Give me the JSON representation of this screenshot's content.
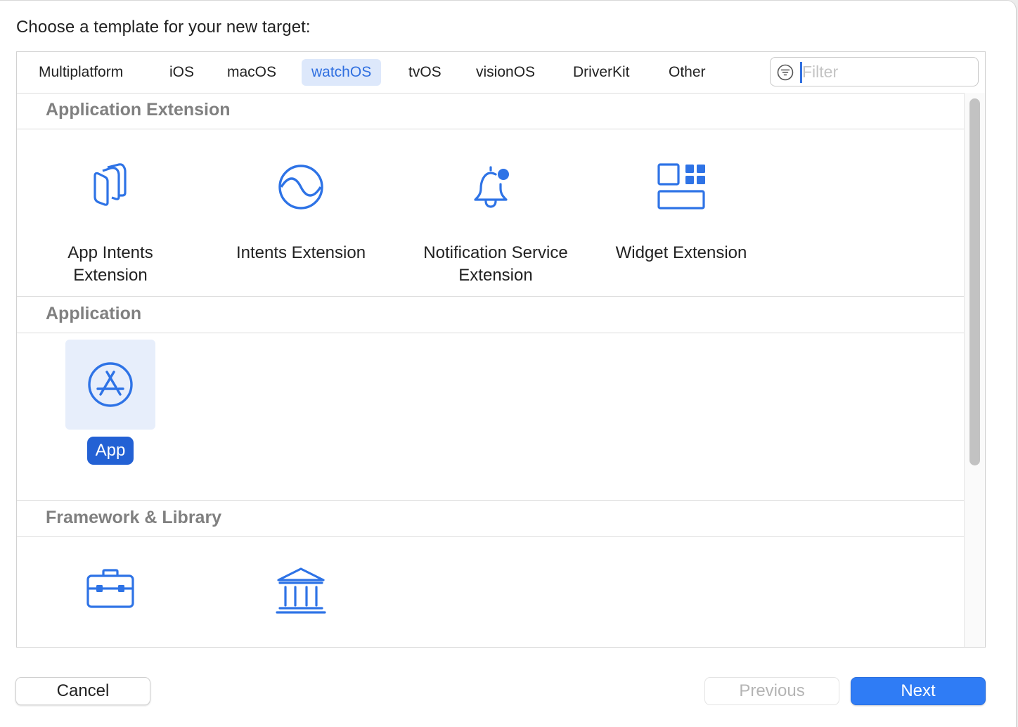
{
  "dialog": {
    "prompt": "Choose a template for your new target:"
  },
  "tabs": [
    {
      "label": "Multiplatform"
    },
    {
      "label": "iOS"
    },
    {
      "label": "macOS"
    },
    {
      "label": "watchOS",
      "selected": true
    },
    {
      "label": "tvOS"
    },
    {
      "label": "visionOS"
    },
    {
      "label": "DriverKit"
    },
    {
      "label": "Other"
    }
  ],
  "filter": {
    "placeholder": "Filter",
    "value": ""
  },
  "sections": [
    {
      "title": "Application Extension",
      "items": [
        {
          "label": "App Intents Extension",
          "icon": "app-intents-icon"
        },
        {
          "label": "Intents Extension",
          "icon": "intents-icon"
        },
        {
          "label": "Notification Service Extension",
          "icon": "bell-badge-icon"
        },
        {
          "label": "Widget Extension",
          "icon": "widget-grid-icon"
        }
      ]
    },
    {
      "title": "Application",
      "items": [
        {
          "label": "App",
          "icon": "app-store-icon",
          "selected": true
        }
      ]
    },
    {
      "title": "Framework & Library",
      "items": [
        {
          "label": "",
          "icon": "toolbox-icon"
        },
        {
          "label": "",
          "icon": "library-building-icon"
        }
      ]
    }
  ],
  "buttons": {
    "cancel": "Cancel",
    "previous": "Previous",
    "next": "Next"
  },
  "colors": {
    "accent": "#2f7cf5",
    "icon_blue": "#2e73e6",
    "selection_label": "#2361d4",
    "selection_bg": "#e7eefb",
    "section_title": "#808080"
  }
}
